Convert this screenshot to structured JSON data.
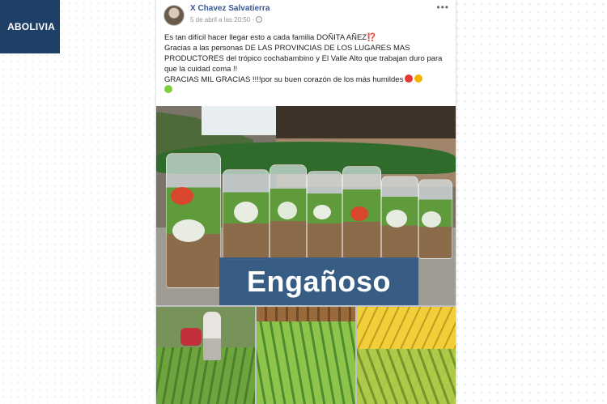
{
  "brand": {
    "label": "ABOLIVIA",
    "color": "#1e3f66"
  },
  "post": {
    "author": "X Chavez Salvatierra",
    "timestamp": "5 de abril a las 20:50 ·",
    "menu_icon": "more-horizontal-icon",
    "text_lines": [
      "Es tan difícil hacer llegar esto a cada familia DOÑITA AÑEZ⁉️",
      "Gracias a las personas DE LAS PROVINCIAS DE LOS LUGARES MAS PRODUCTORES del trópico cochabambino y El Valle Alto que trabajan duro para que la cuidad coma !!",
      "GRACIAS MIL GRACIAS !!!!por su buen corazón de los más humildes"
    ],
    "hearts": [
      "#e53935",
      "#f5b300",
      "#7fcf3a"
    ]
  },
  "photo": {
    "verdict_label": "Engañoso",
    "verdict_color": "#305884"
  }
}
